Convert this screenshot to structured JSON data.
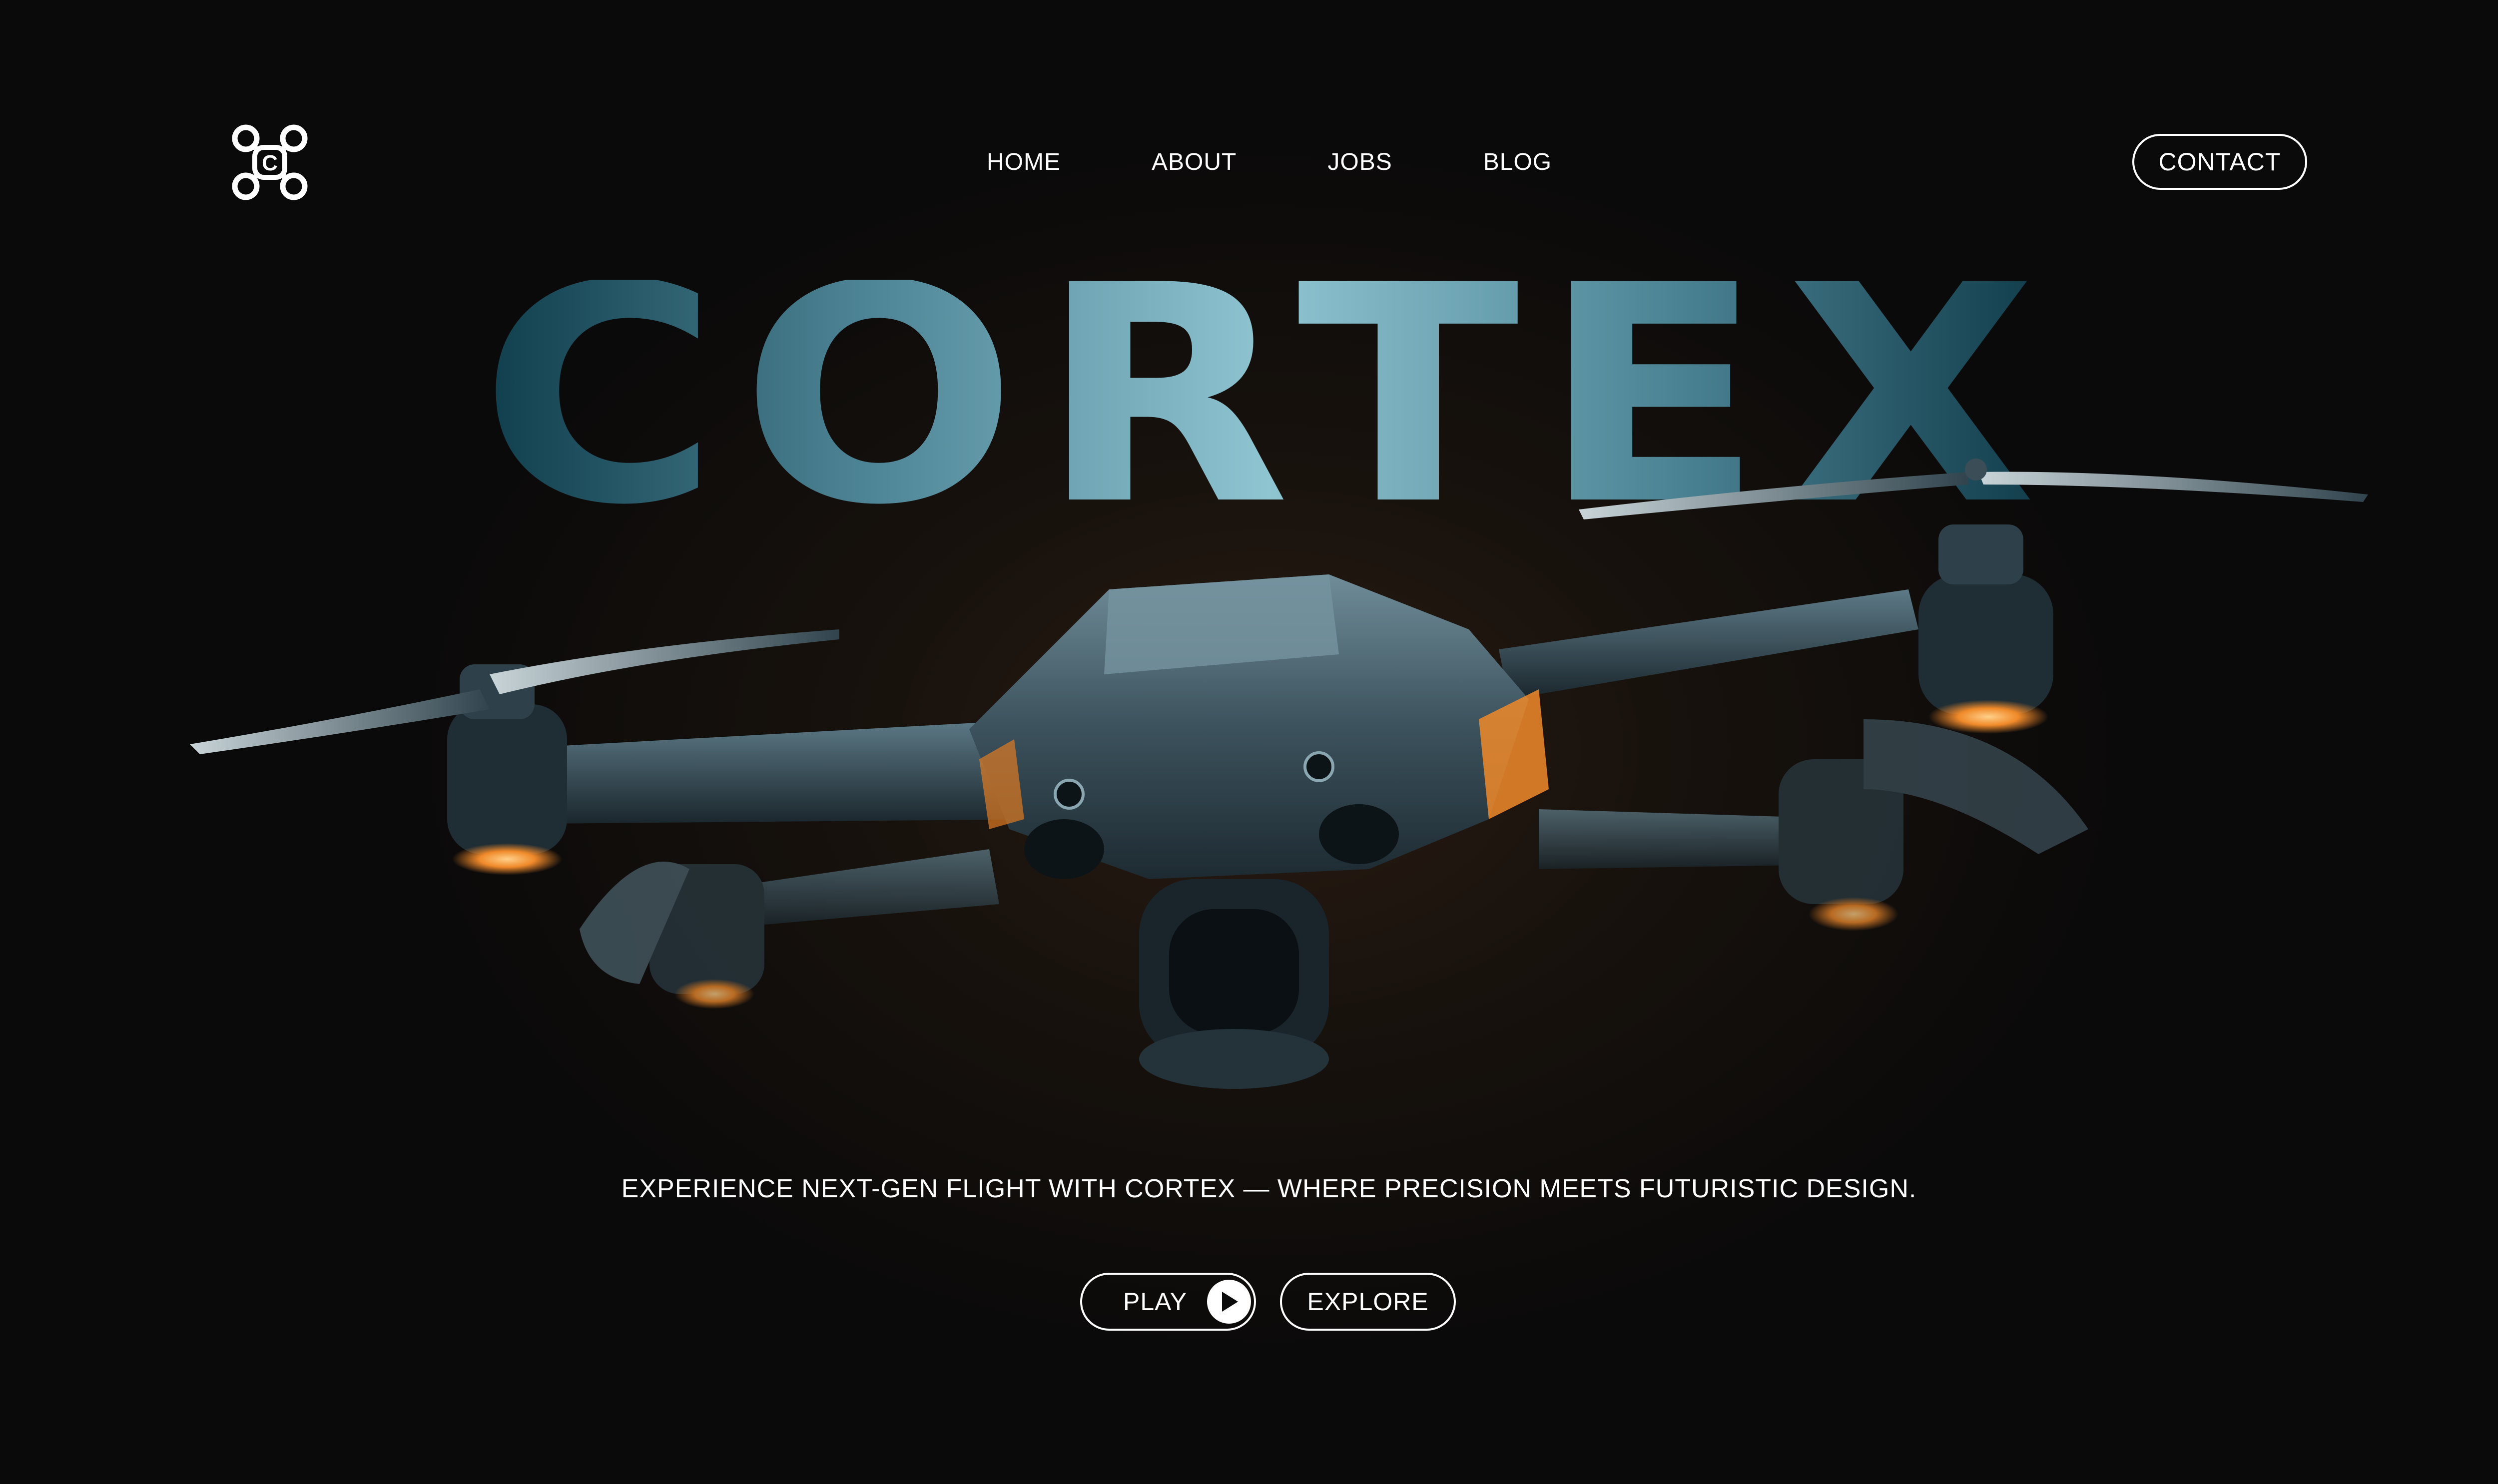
{
  "nav": {
    "items": [
      {
        "label": "HOME"
      },
      {
        "label": "ABOUT"
      },
      {
        "label": "JOBS"
      },
      {
        "label": "BLOG"
      }
    ],
    "contact_label": "CONTACT"
  },
  "logo": {
    "icon": "drone-logo-icon",
    "letter": "C"
  },
  "hero": {
    "title": "CORTEX",
    "tagline": "EXPERIENCE NEXT-GEN FLIGHT WITH CORTEX — WHERE PRECISION MEETS FUTURISTIC DESIGN."
  },
  "cta": {
    "play_label": "PLAY",
    "explore_label": "EXPLORE"
  },
  "colors": {
    "background": "#0b0a0a",
    "title_gradient_start": "#0f3a48",
    "title_gradient_mid": "#8ec3d0",
    "title_gradient_end": "#103a48",
    "accent_orange": "#f08a2a",
    "drone_body": "#3e5561",
    "text": "#ffffff"
  }
}
